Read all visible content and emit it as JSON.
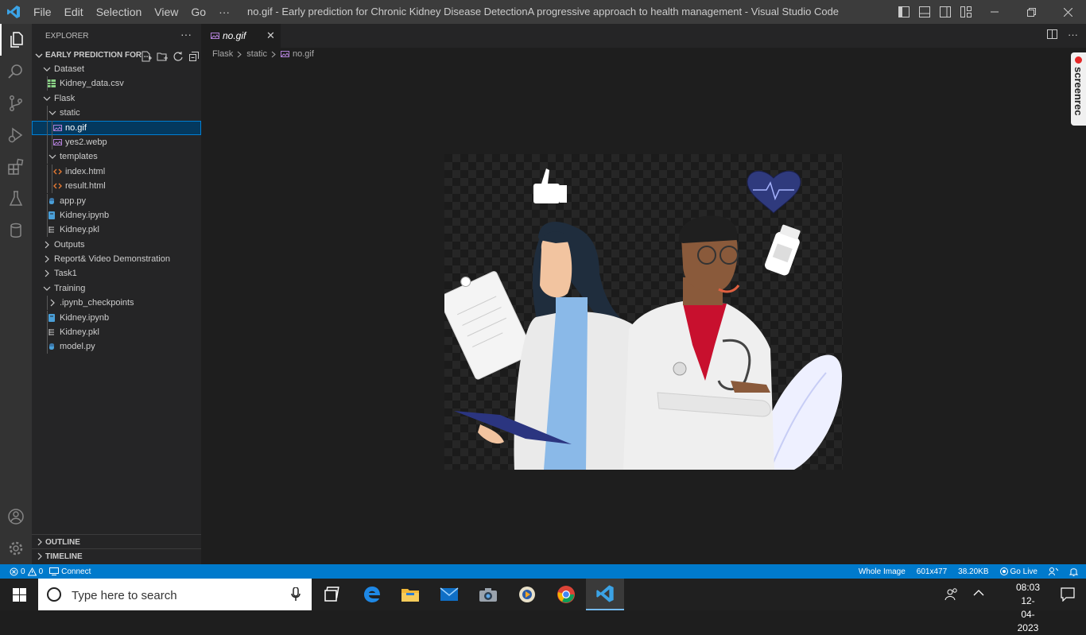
{
  "titlebar": {
    "menu": [
      "File",
      "Edit",
      "Selection",
      "View",
      "Go",
      "···"
    ],
    "title": "no.gif - Early prediction for Chronic Kidney Disease DetectionA progressive approach to health management - Visual Studio Code"
  },
  "sidebar": {
    "header": "EXPLORER",
    "more": "···",
    "project": "EARLY PREDICTION FOR ...",
    "tree": [
      {
        "label": "Dataset",
        "type": "folder-open",
        "depth": 0
      },
      {
        "label": "Kidney_data.csv",
        "type": "csv",
        "depth": 1
      },
      {
        "label": "Flask",
        "type": "folder-open",
        "depth": 0
      },
      {
        "label": "static",
        "type": "folder-open",
        "depth": 1
      },
      {
        "label": "no.gif",
        "type": "image",
        "depth": 2,
        "selected": true
      },
      {
        "label": "yes2.webp",
        "type": "image",
        "depth": 2
      },
      {
        "label": "templates",
        "type": "folder-open",
        "depth": 1
      },
      {
        "label": "index.html",
        "type": "html",
        "depth": 2
      },
      {
        "label": "result.html",
        "type": "html",
        "depth": 2
      },
      {
        "label": "app.py",
        "type": "python",
        "depth": 1
      },
      {
        "label": "Kidney.ipynb",
        "type": "notebook",
        "depth": 1
      },
      {
        "label": "Kidney.pkl",
        "type": "file",
        "depth": 1
      },
      {
        "label": "Outputs",
        "type": "folder-closed",
        "depth": 0
      },
      {
        "label": "Report& Video Demonstration",
        "type": "folder-closed",
        "depth": 0
      },
      {
        "label": "Task1",
        "type": "folder-closed",
        "depth": 0
      },
      {
        "label": "Training",
        "type": "folder-open",
        "depth": 0
      },
      {
        "label": ".ipynb_checkpoints",
        "type": "folder-closed",
        "depth": 1
      },
      {
        "label": "Kidney.ipynb",
        "type": "notebook",
        "depth": 1
      },
      {
        "label": "Kidney.pkl",
        "type": "file",
        "depth": 1
      },
      {
        "label": "model.py",
        "type": "python",
        "depth": 1
      }
    ],
    "outline": "OUTLINE",
    "timeline": "TIMELINE"
  },
  "editor": {
    "tab_label": "no.gif",
    "breadcrumbs": [
      "Flask",
      "static",
      "no.gif"
    ]
  },
  "overlay": {
    "screenrec": "screenrec"
  },
  "statusbar": {
    "errors": "0",
    "warnings": "0",
    "connect": "Connect",
    "zoom": "Whole Image",
    "dimensions": "601x477",
    "size": "38.20KB",
    "golive": "Go Live"
  },
  "taskbar": {
    "search_placeholder": "Type here to search",
    "time": "08:03",
    "date": "12-04-2023"
  },
  "colors": {
    "statusbar": "#007acc",
    "activitybar": "#333333",
    "sidebar": "#252526",
    "editor": "#1e1e1e",
    "titlebar": "#3c3c3c",
    "selection": "#04395e"
  }
}
